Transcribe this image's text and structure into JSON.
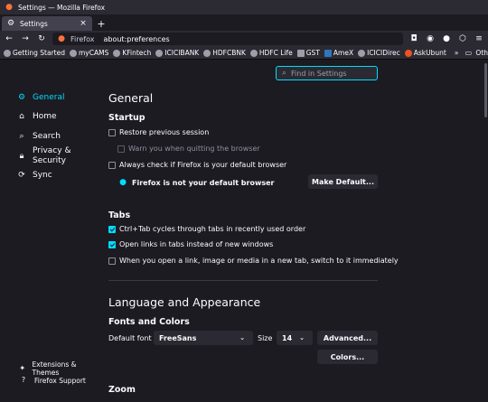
{
  "window": {
    "title": "Settings — Mozilla Firefox"
  },
  "tabs": [
    {
      "label": "Settings"
    }
  ],
  "new_tab_symbol": "+",
  "navbar": {
    "identity_label": "Firefox",
    "url": "about:preferences"
  },
  "bookmarks": {
    "items": [
      "Getting Started",
      "myCAMS",
      "KFintech",
      "ICICIBANK",
      "HDFCBNK",
      "HDFC Life",
      "GST",
      "AmeX",
      "ICICIDirec",
      "AskUbunt"
    ],
    "overflow": "»",
    "other": "Other Bookmarks"
  },
  "search": {
    "placeholder": "Find in Settings"
  },
  "sidebar": {
    "items": [
      {
        "label": "General",
        "icon": "gear-icon",
        "selected": true
      },
      {
        "label": "Home",
        "icon": "home-icon"
      },
      {
        "label": "Search",
        "icon": "search-icon"
      },
      {
        "label": "Privacy &\nSecurity",
        "icon": "lock-icon"
      },
      {
        "label": "Sync",
        "icon": "sync-icon"
      }
    ],
    "footer": [
      {
        "label": "Extensions & Themes",
        "icon": "puzzle-icon"
      },
      {
        "label": "Firefox Support",
        "icon": "help-icon"
      }
    ]
  },
  "general": {
    "title": "General",
    "startup": {
      "heading": "Startup",
      "restore": "Restore previous session",
      "warn": "Warn you when quitting the browser",
      "always_check": "Always check if Firefox is your default browser",
      "not_default": "Firefox is not your default browser",
      "make_default": "Make Default..."
    },
    "tabs": {
      "heading": "Tabs",
      "ctrl_tab": "Ctrl+Tab cycles through tabs in recently used order",
      "open_links": "Open links in tabs instead of new windows",
      "switch_tab": "When you open a link, image or media in a new tab, switch to it immediately"
    },
    "language": {
      "title": "Language and Appearance",
      "fonts_heading": "Fonts and Colors",
      "default_font_label": "Default font",
      "default_font_value": "FreeSans",
      "size_label": "Size",
      "size_value": "14",
      "advanced": "Advanced...",
      "colors": "Colors..."
    },
    "zoom": {
      "heading": "Zoom"
    }
  },
  "colors": {
    "accent": "#00ddff",
    "background": "#1c1b22",
    "toolbar": "#2b2a33"
  }
}
